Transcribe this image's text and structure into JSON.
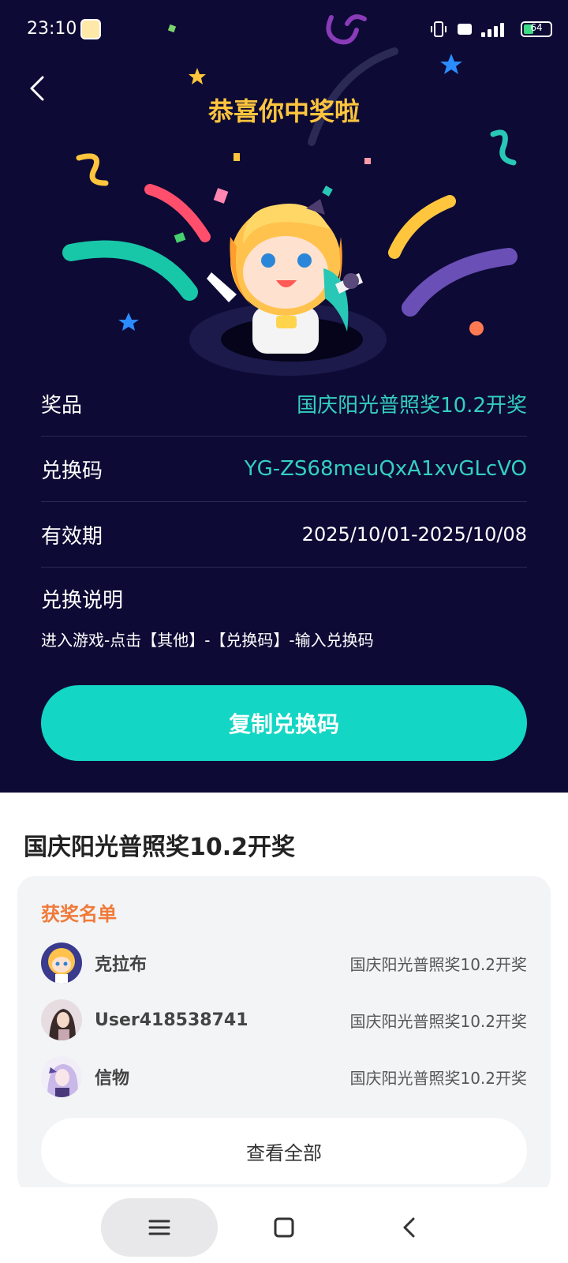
{
  "status": {
    "time": "23:10",
    "battery": "64"
  },
  "header": {
    "title": "恭喜你中奖啦"
  },
  "details": {
    "prize_label": "奖品",
    "prize_value": "国庆阳光普照奖10.2开奖",
    "code_label": "兑换码",
    "code_value": "YG-ZS68meuQxA1xvGLcVO",
    "validity_label": "有效期",
    "validity_value": "2025/10/01-2025/10/08",
    "explain_label": "兑换说明",
    "explain_text": "进入游戏-点击【其他】-【兑换码】-输入兑换码"
  },
  "copy_button": "复制兑换码",
  "event": {
    "name": "国庆阳光普照奖10.2开奖"
  },
  "winners": {
    "title": "获奖名单",
    "items": [
      {
        "user": "克拉布",
        "prize": "国庆阳光普照奖10.2开奖"
      },
      {
        "user": "User418538741",
        "prize": "国庆阳光普照奖10.2开奖"
      },
      {
        "user": "信物",
        "prize": "国庆阳光普照奖10.2开奖"
      }
    ],
    "view_all": "查看全部"
  },
  "colors": {
    "bg_dark": "#0d0a35",
    "accent": "#13d6c4",
    "title_gold": "#ffc53d",
    "list_title": "#f07a3a"
  },
  "icons": [
    "back-arrow-icon",
    "menu-icon",
    "home-icon",
    "nav-back-icon"
  ]
}
